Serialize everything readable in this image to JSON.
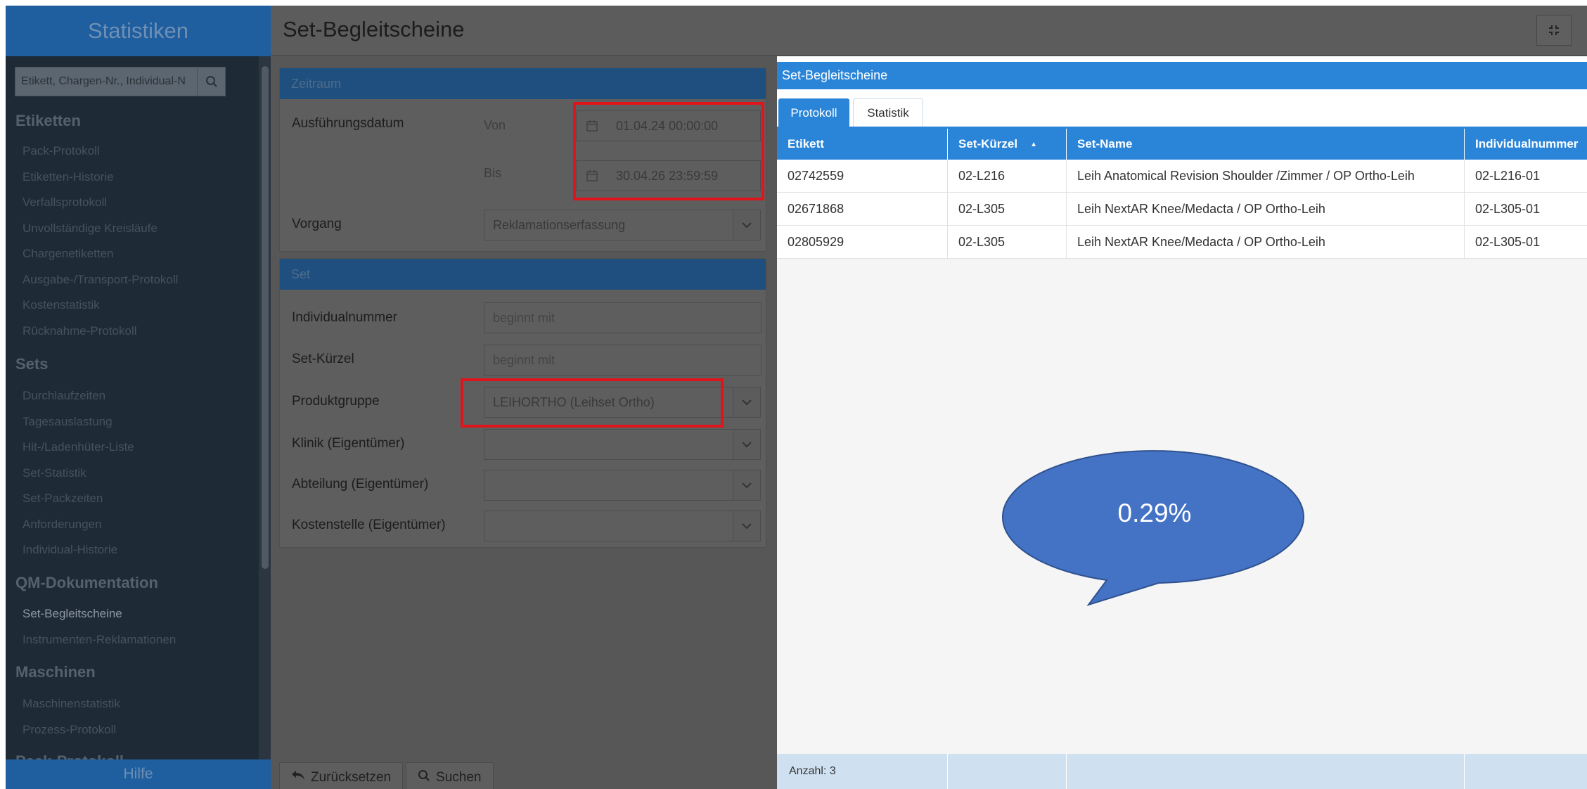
{
  "sidebar": {
    "title": "Statistiken",
    "search_placeholder": "Etikett, Chargen-Nr., Individual-N",
    "sections": [
      {
        "heading": "Etiketten",
        "items": [
          "Pack-Protokoll",
          "Etiketten-Historie",
          "Verfallsprotokoll",
          "Unvollständige Kreisläufe",
          "Chargenetiketten",
          "Ausgabe-/Transport-Protokoll",
          "Kostenstatistik",
          "Rücknahme-Protokoll"
        ]
      },
      {
        "heading": "Sets",
        "items": [
          "Durchlaufzeiten",
          "Tagesauslastung",
          "Hit-/Ladenhüter-Liste",
          "Set-Statistik",
          "Set-Packzeiten",
          "Anforderungen",
          "Individual-Historie"
        ]
      },
      {
        "heading": "QM-Dokumentation",
        "items": [
          "Set-Begleitscheine",
          "Instrumenten-Reklamationen"
        ]
      },
      {
        "heading": "Maschinen",
        "items": [
          "Maschinenstatistik",
          "Prozess-Protokoll"
        ]
      },
      {
        "heading": "Pack-Protokoll",
        "items": []
      }
    ],
    "active_item": "Set-Begleitscheine",
    "help_label": "Hilfe"
  },
  "header": {
    "title": "Set-Begleitscheine",
    "fullscreen_icon": "collapse-icon"
  },
  "filters": {
    "zeitraum": {
      "heading": "Zeitraum",
      "date_label": "Ausführungsdatum",
      "from_label": "Von",
      "from_value": "01.04.24 00:00:00",
      "to_label": "Bis",
      "to_value": "30.04.26 23:59:59",
      "vorgang_label": "Vorgang",
      "vorgang_value": "Reklamationserfassung"
    },
    "set": {
      "heading": "Set",
      "individualnummer_label": "Individualnummer",
      "individualnummer_placeholder": "beginnt mit",
      "setkuerzel_label": "Set-Kürzel",
      "setkuerzel_placeholder": "beginnt mit",
      "produktgruppe_label": "Produktgruppe",
      "produktgruppe_value": "LEIHORTHO (Leihset Ortho)",
      "klinik_label": "Klinik (Eigentümer)",
      "klinik_value": "",
      "abteilung_label": "Abteilung (Eigentümer)",
      "abteilung_value": "",
      "kostenstelle_label": "Kostenstelle (Eigentümer)",
      "kostenstelle_value": ""
    },
    "buttons": {
      "reset_label": "Zurücksetzen",
      "search_label": "Suchen"
    }
  },
  "result": {
    "title": "Set-Begleitscheine",
    "tabs": [
      "Protokoll",
      "Statistik"
    ],
    "active_tab": "Protokoll",
    "columns": [
      "Etikett",
      "Set-Kürzel",
      "Set-Name",
      "Individualnummer"
    ],
    "rows": [
      [
        "02742559",
        "02-L216",
        "Leih Anatomical Revision Shoulder /Zimmer / OP Ortho-Leih",
        "02-L216-01"
      ],
      [
        "02671868",
        "02-L305",
        "Leih NextAR Knee/Medacta / OP Ortho-Leih",
        "02-L305-01"
      ],
      [
        "02805929",
        "02-L305",
        "Leih NextAR Knee/Medacta / OP Ortho-Leih",
        "02-L305-01"
      ]
    ],
    "count_label": "Anzahl: 3"
  },
  "annotation": {
    "callout_text": "0.29%",
    "callout_color": "#4472c4",
    "highlight_color": "#e0141b"
  }
}
